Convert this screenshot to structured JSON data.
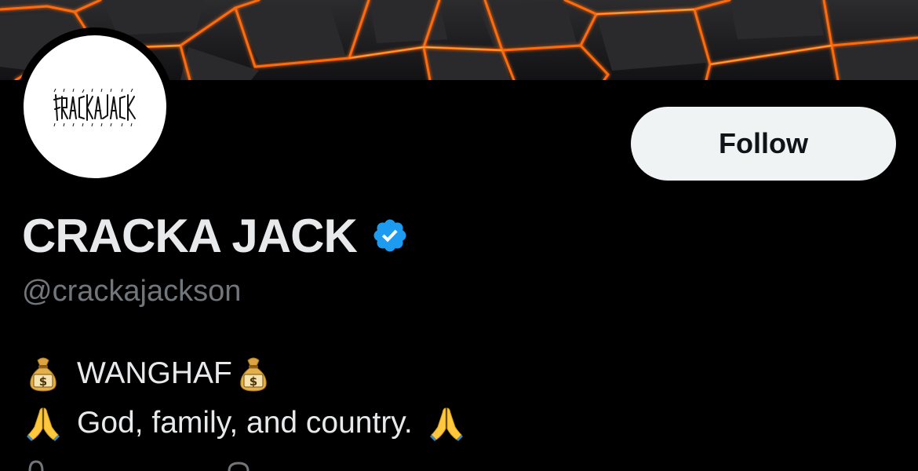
{
  "profile": {
    "display_name": "CRACKA JACK",
    "handle": "@crackajackson",
    "verified": true,
    "avatar_text": "CRACKAJACK"
  },
  "actions": {
    "follow_label": "Follow"
  },
  "bio": {
    "line1_text": "WANGHAF",
    "line2_text": "God, family, and country."
  },
  "icons": {
    "verified": "verified-badge-icon",
    "money_bag": "money-bag-emoji",
    "folded_hands": "folded-hands-emoji",
    "location": "location-icon",
    "link": "link-icon"
  },
  "colors": {
    "background": "#000000",
    "text_primary": "#e7e9ea",
    "text_secondary": "#71767b",
    "verified_blue": "#1d9bf0",
    "follow_button_bg": "#eff3f4",
    "follow_button_text": "#0f1419",
    "lava_orange": "#ff7a1a"
  }
}
